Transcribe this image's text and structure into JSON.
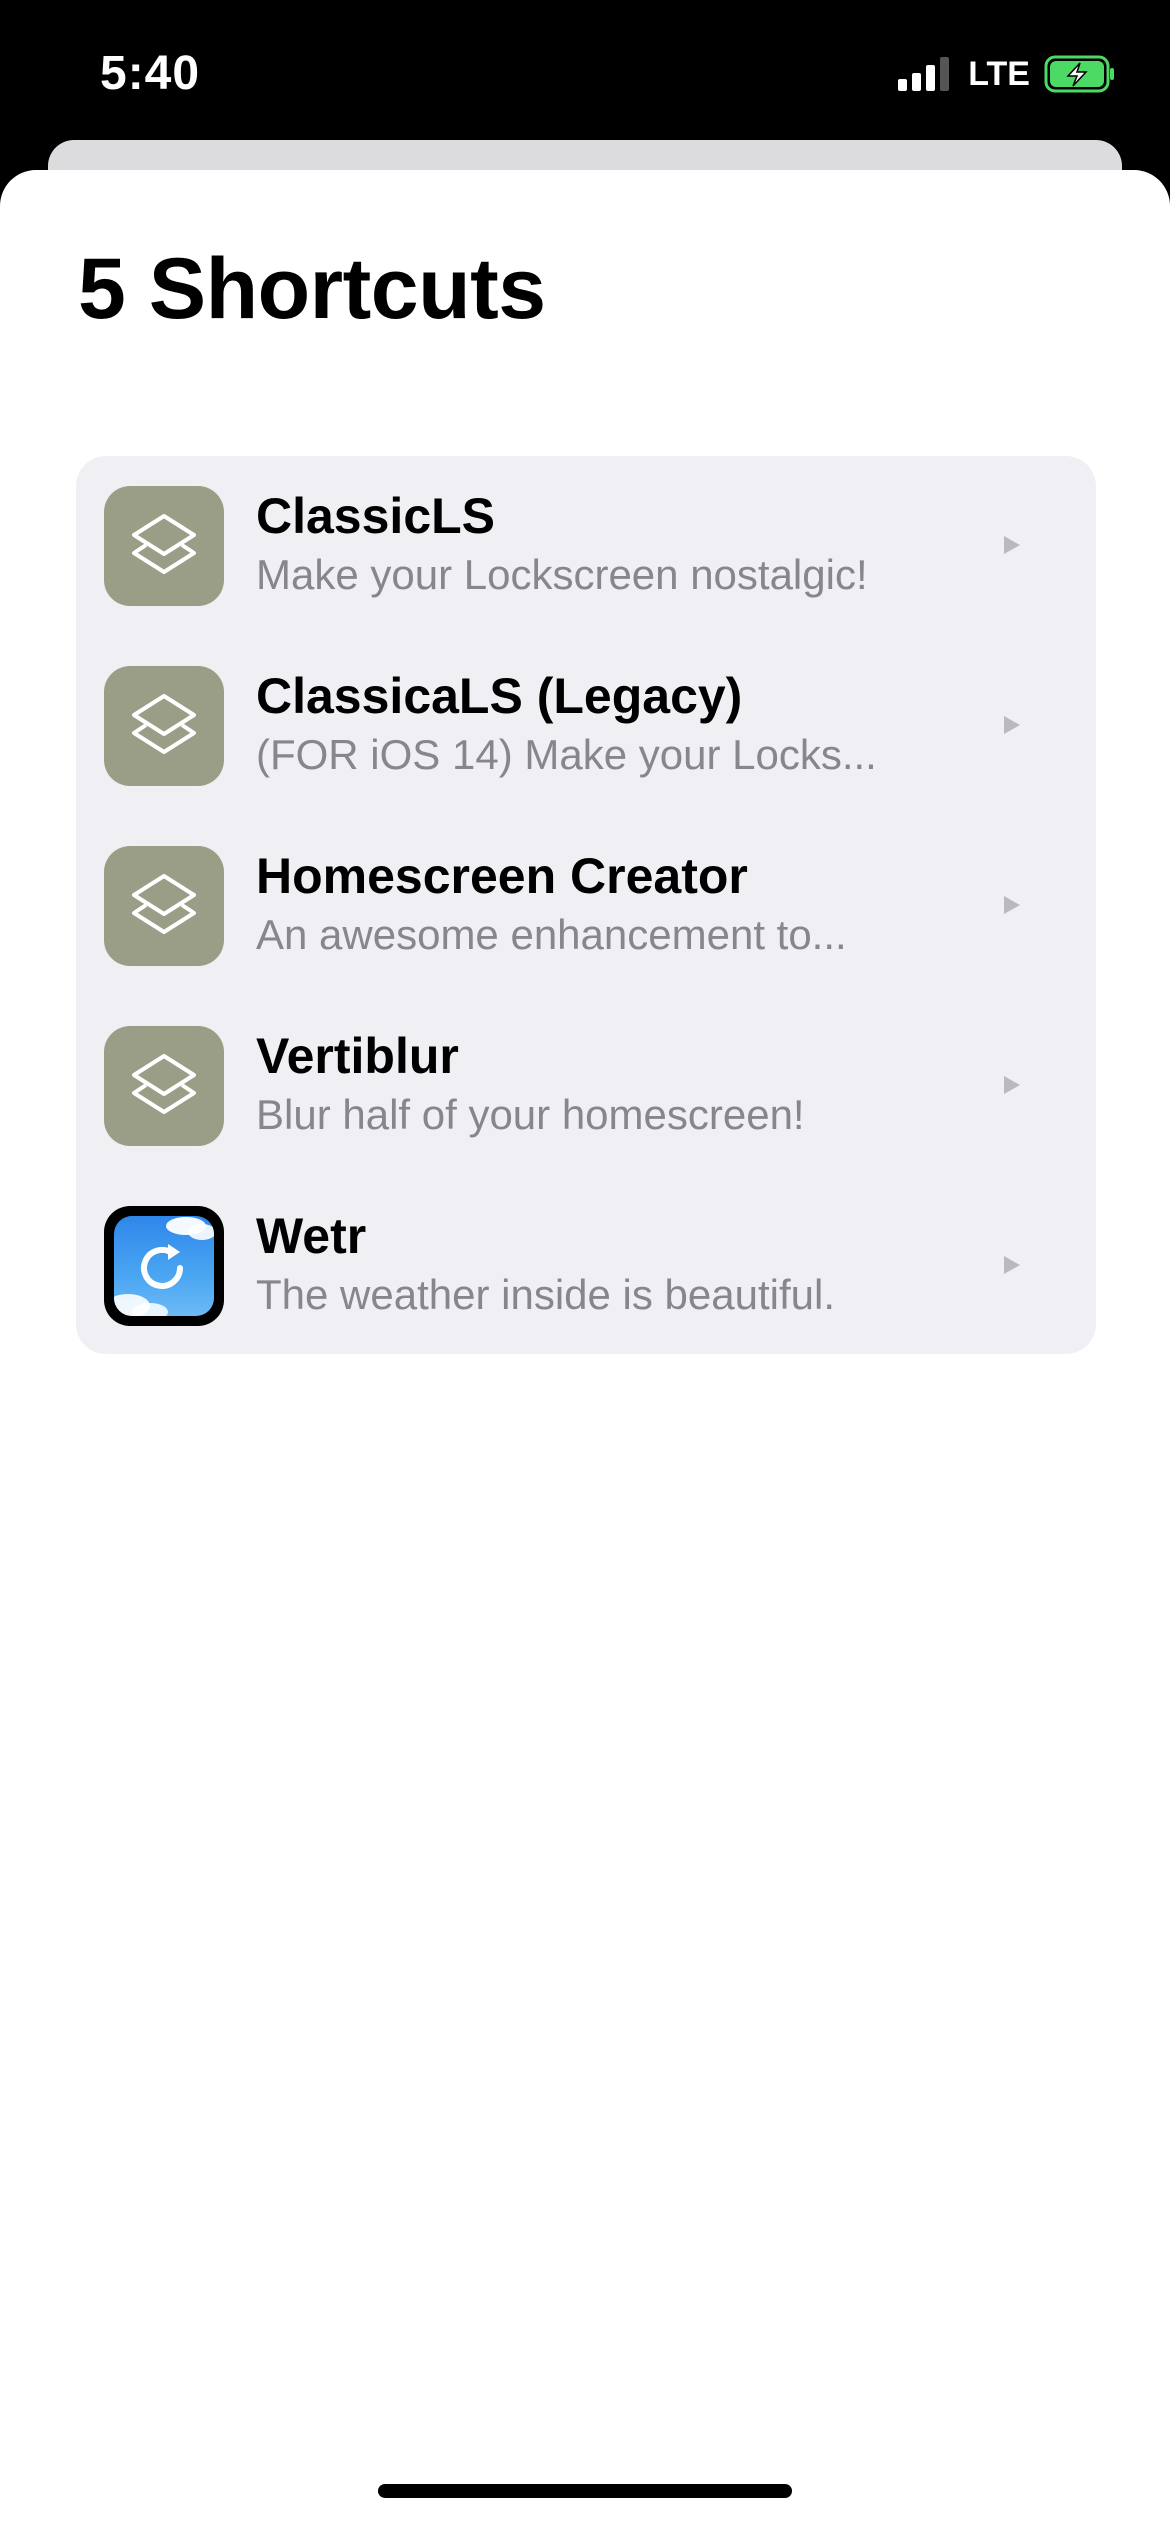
{
  "status_bar": {
    "time": "5:40",
    "network": "LTE",
    "battery_color": "#4cd964"
  },
  "sheet": {
    "title": "5 Shortcuts"
  },
  "shortcuts": [
    {
      "title": "ClassicLS",
      "subtitle": "Make your Lockscreen nostalgic!",
      "icon": "shortcuts-layers-icon"
    },
    {
      "title": "ClassicaLS (Legacy)",
      "subtitle": "(FOR iOS 14) Make your Locks...",
      "icon": "shortcuts-layers-icon"
    },
    {
      "title": "Homescreen Creator",
      "subtitle": "An awesome enhancement to...",
      "icon": "shortcuts-layers-icon"
    },
    {
      "title": "Vertiblur",
      "subtitle": "Blur half of your homescreen!",
      "icon": "shortcuts-layers-icon"
    },
    {
      "title": "Wetr",
      "subtitle": "The weather inside is beautiful.",
      "icon": "weather-refresh-icon"
    }
  ],
  "colors": {
    "shortcut_icon_bg": "#9a9e86",
    "list_bg": "#f0eff4",
    "subtitle": "#86868b"
  }
}
